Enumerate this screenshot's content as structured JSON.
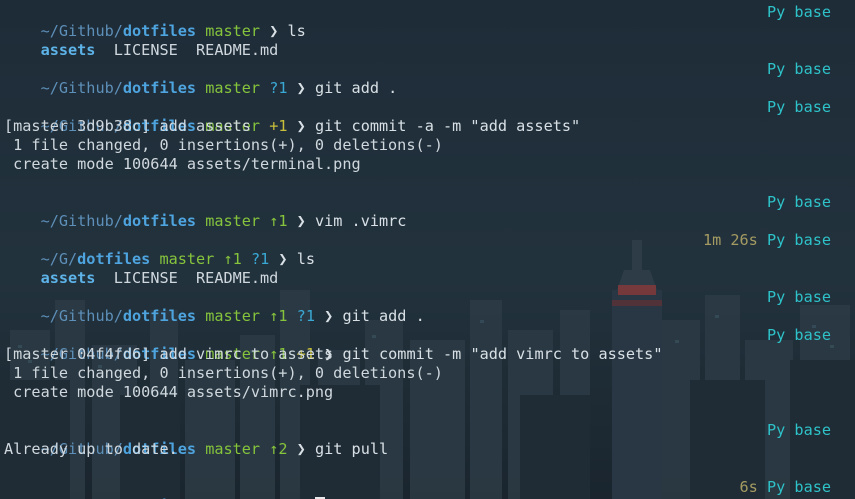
{
  "prompt": {
    "path_full": "~/Github/",
    "path_short": "~/G/",
    "repo": "dotfiles",
    "branch": "master",
    "arrow": "❯",
    "env_py": "Py",
    "env_name": "base"
  },
  "blocks": [
    {
      "status": "",
      "command": "ls",
      "duration": ""
    },
    {
      "status": "?1",
      "command": "git add .",
      "duration": ""
    },
    {
      "status": "+1",
      "command": "git commit -a -m \"add assets\"",
      "duration": ""
    },
    {
      "status": "↑1",
      "command": "vim .vimrc",
      "duration": ""
    },
    {
      "status_a": "↑1",
      "status_b": "?1",
      "command": "ls",
      "duration": "1m 26s"
    },
    {
      "status_a": "↑1",
      "status_b": "?1",
      "command": "git add .",
      "duration": ""
    },
    {
      "status_a": "↑1",
      "status_b": "+1",
      "command": "git commit -m \"add vimrc to assets\"",
      "duration": ""
    },
    {
      "status": "↑2",
      "command": "git pull",
      "duration": ""
    },
    {
      "status": "↑2",
      "command": "",
      "duration": "6s"
    }
  ],
  "outputs": {
    "ls1": {
      "dir": "assets",
      "files": "  LICENSE  README.md"
    },
    "commit1": [
      "[master 3d9b38c] add assets",
      " 1 file changed, 0 insertions(+), 0 deletions(-)",
      " create mode 100644 assets/terminal.png"
    ],
    "ls2": {
      "dir": "assets",
      "files": "  LICENSE  README.md"
    },
    "commit2": [
      "[master 04f4fd6] add vimrc to assets",
      " 1 file changed, 0 insertions(+), 0 deletions(-)",
      " create mode 100644 assets/vimrc.png"
    ],
    "pull": "Already up to date."
  }
}
